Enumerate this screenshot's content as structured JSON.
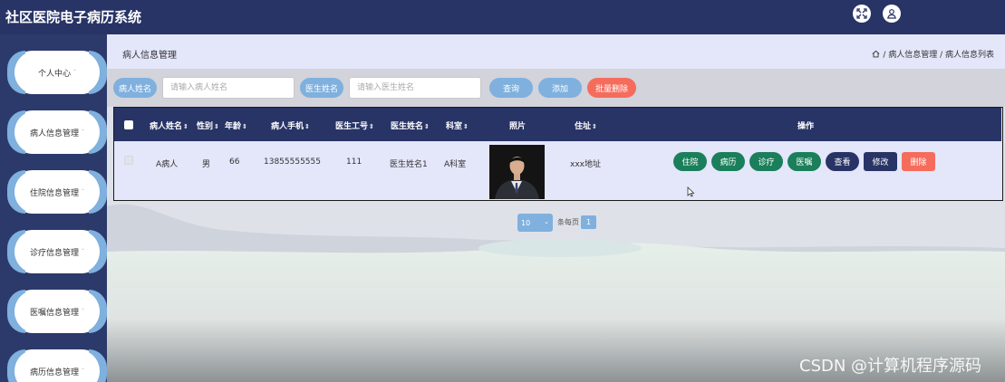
{
  "app": {
    "title": "社区医院电子病历系统",
    "fullscreen_icon": "fullscreen-icon",
    "user_icon": "user-icon"
  },
  "sidebar": {
    "items": [
      {
        "label": "个人中心"
      },
      {
        "label": "病人信息管理"
      },
      {
        "label": "住院信息管理"
      },
      {
        "label": "诊疗信息管理"
      },
      {
        "label": "医嘱信息管理"
      },
      {
        "label": "病历信息管理"
      }
    ],
    "chevron": "ˇ"
  },
  "header": {
    "page_title": "病人信息管理",
    "breadcrumb": "/ 病人信息管理 / 病人信息列表",
    "home_icon": "home-icon"
  },
  "search": {
    "patient_label": "病人姓名",
    "patient_placeholder": "请输入病人姓名",
    "doctor_label": "医生姓名",
    "doctor_placeholder": "请输入医生姓名",
    "query_label": "查询",
    "add_label": "添加",
    "batch_delete_label": "批量删除"
  },
  "table": {
    "columns": [
      "病人姓名",
      "性别",
      "年龄",
      "病人手机",
      "医生工号",
      "医生姓名",
      "科室",
      "照片",
      "住址",
      "操作"
    ],
    "sort_glyph": "⇕",
    "rows": [
      {
        "patient_name": "A病人",
        "gender": "男",
        "age": "66",
        "phone": "13855555555",
        "doctor_id": "111",
        "doctor_name": "医生姓名1",
        "department": "A科室",
        "address": "xxx地址",
        "actions": [
          "住院",
          "病历",
          "诊疗",
          "医嘱",
          "查看",
          "修改",
          "删除"
        ]
      }
    ]
  },
  "pagination": {
    "page_size": "10",
    "per_page_label": "条每页",
    "current_page": "1"
  },
  "watermark": "CSDN @计算机程序源码",
  "colors": {
    "nav": "#283466",
    "accent": "#7fb0de",
    "green": "#1a7f5a",
    "navy": "#283466",
    "red": "#f56c5c"
  }
}
